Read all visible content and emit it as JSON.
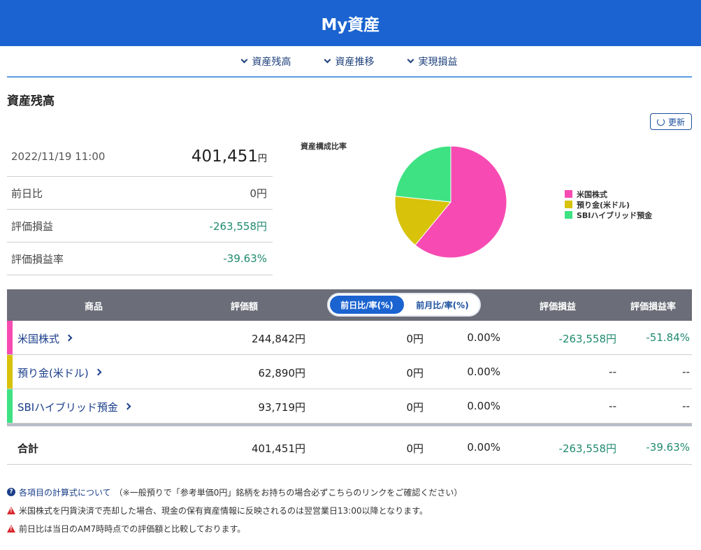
{
  "header": {
    "title": "My資産"
  },
  "nav": {
    "anchors": [
      "資産残高",
      "資産推移",
      "実現損益"
    ]
  },
  "section": {
    "title": "資産残高",
    "refresh_label": "更新"
  },
  "summary": {
    "datetime": "2022/11/19 11:00",
    "total_value": "401,451",
    "total_unit": "円",
    "rows": [
      {
        "label": "前日比",
        "value": "0円"
      },
      {
        "label": "評価損益",
        "value": "-263,558円"
      },
      {
        "label": "評価損益率",
        "value": "-39.63%"
      }
    ]
  },
  "chart_title": "資産構成比率",
  "chart_data": {
    "type": "pie",
    "title": "資産構成比率",
    "labels": [
      "米国株式",
      "預り金(米ドル)",
      "SBIハイブリッド預金"
    ],
    "values": [
      244842,
      62890,
      93719
    ],
    "colors": [
      "#f74bb3",
      "#d8c20a",
      "#3ee283"
    ],
    "legend": "right"
  },
  "table": {
    "headers": {
      "product": "商品",
      "value": "評価額",
      "toggle_day": "前日比/率(%)",
      "toggle_month": "前月比/率(%)",
      "pl": "評価損益",
      "pl_rate": "評価損益率"
    },
    "rows": [
      {
        "name": "米国株式",
        "value": "244,842円",
        "diff": "0円",
        "diff_rate": "0.00%",
        "pl": "-263,558円",
        "pl_rate": "-51.84%",
        "color": "#f74bb3"
      },
      {
        "name": "預り金(米ドル)",
        "value": "62,890円",
        "diff": "0円",
        "diff_rate": "0.00%",
        "pl": "--",
        "pl_rate": "--",
        "color": "#d8c20a"
      },
      {
        "name": "SBIハイブリッド預金",
        "value": "93,719円",
        "diff": "0円",
        "diff_rate": "0.00%",
        "pl": "--",
        "pl_rate": "--",
        "color": "#3ee283"
      }
    ],
    "total": {
      "name": "合計",
      "value": "401,451円",
      "diff": "0円",
      "diff_rate": "0.00%",
      "pl": "-263,558円",
      "pl_rate": "-39.63%"
    }
  },
  "notes": {
    "link_text": "各項目の計算式について",
    "link_suffix": "（※一般預りで「参考単価0円」銘柄をお持ちの場合必ずこちらのリンクをご確認ください）",
    "warning1": "米国株式を円貨決済で売却した場合、現金の保有資産情報に反映されるのは翌営業日13:00以降となります。",
    "warning2": "前日比は当日のAM7時時点での評価額と比較しております。"
  }
}
